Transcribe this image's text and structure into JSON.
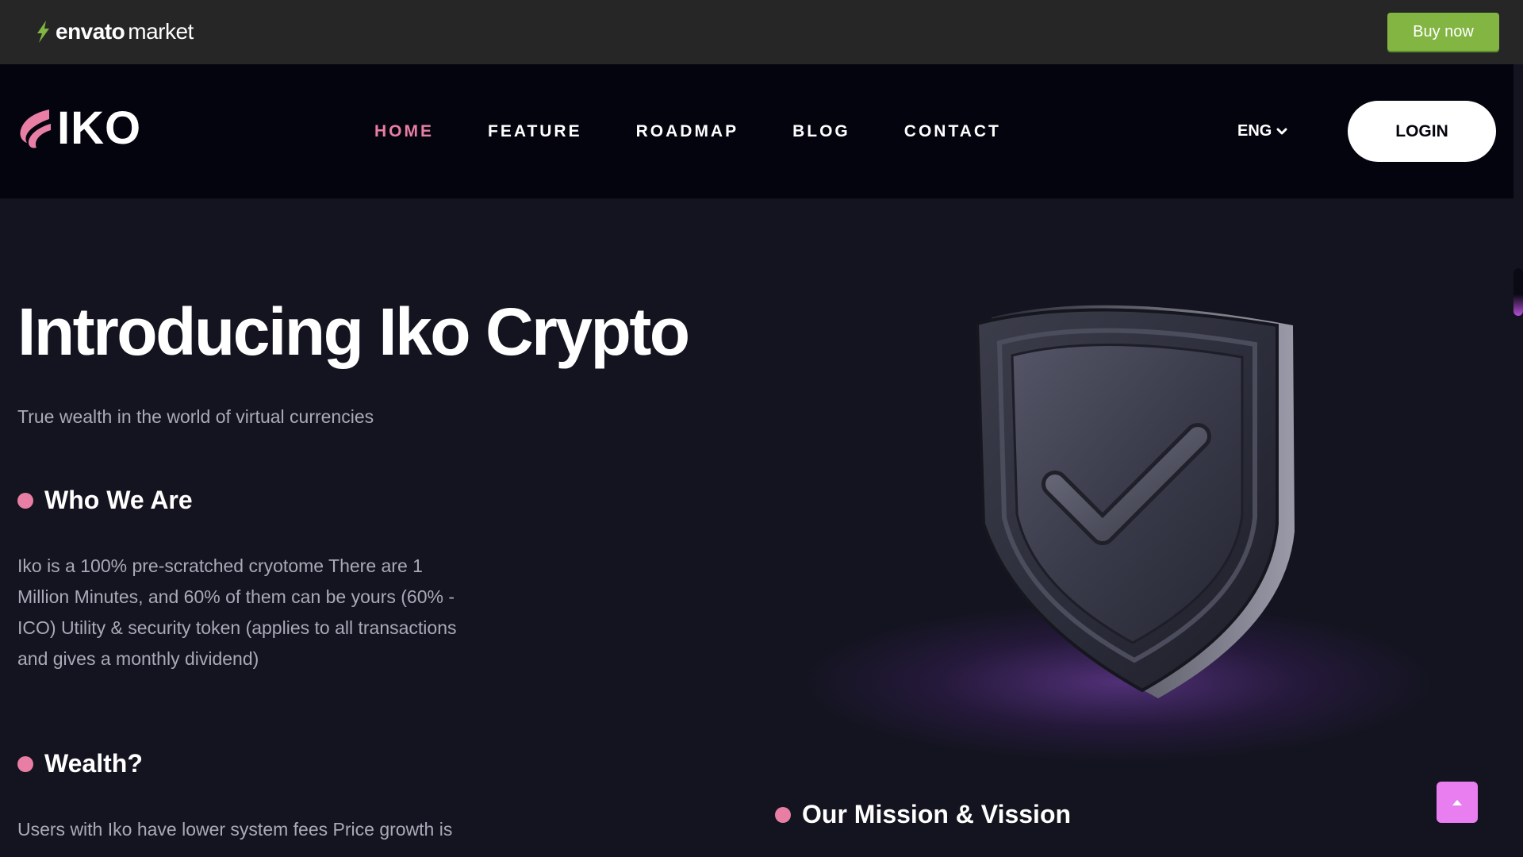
{
  "envato": {
    "brand": "envato",
    "market": "market",
    "buy_label": "Buy now",
    "accent": "#82b541"
  },
  "header": {
    "logo_text": "IKO",
    "nav": [
      {
        "label": "HOME",
        "active": true
      },
      {
        "label": "FEATURE",
        "active": false
      },
      {
        "label": "ROADMAP",
        "active": false
      },
      {
        "label": "BLOG",
        "active": false
      },
      {
        "label": "CONTACT",
        "active": false
      }
    ],
    "language": "ENG",
    "login_label": "LOGIN",
    "accent": "#e87ea4"
  },
  "hero": {
    "title": "Introducing Iko Crypto",
    "subtitle": "True wealth in the world of virtual currencies",
    "image_icon": "shield-check-icon"
  },
  "sections": {
    "who": {
      "heading": "Who We Are",
      "lines": [
        "Iko is a 100% pre-scratched cryotome There are 1",
        "Million Minutes, and 60% of them can be yours (60% -",
        "ICO) Utility & security token (applies to all transactions",
        "and gives a monthly dividend)"
      ]
    },
    "wealth": {
      "heading": "Wealth?",
      "lines": [
        "Users with Iko have lower system fees Price growth is"
      ]
    },
    "mission": {
      "heading": "Our Mission & Vission"
    }
  },
  "scroll_top_icon": "chevron-up-icon"
}
